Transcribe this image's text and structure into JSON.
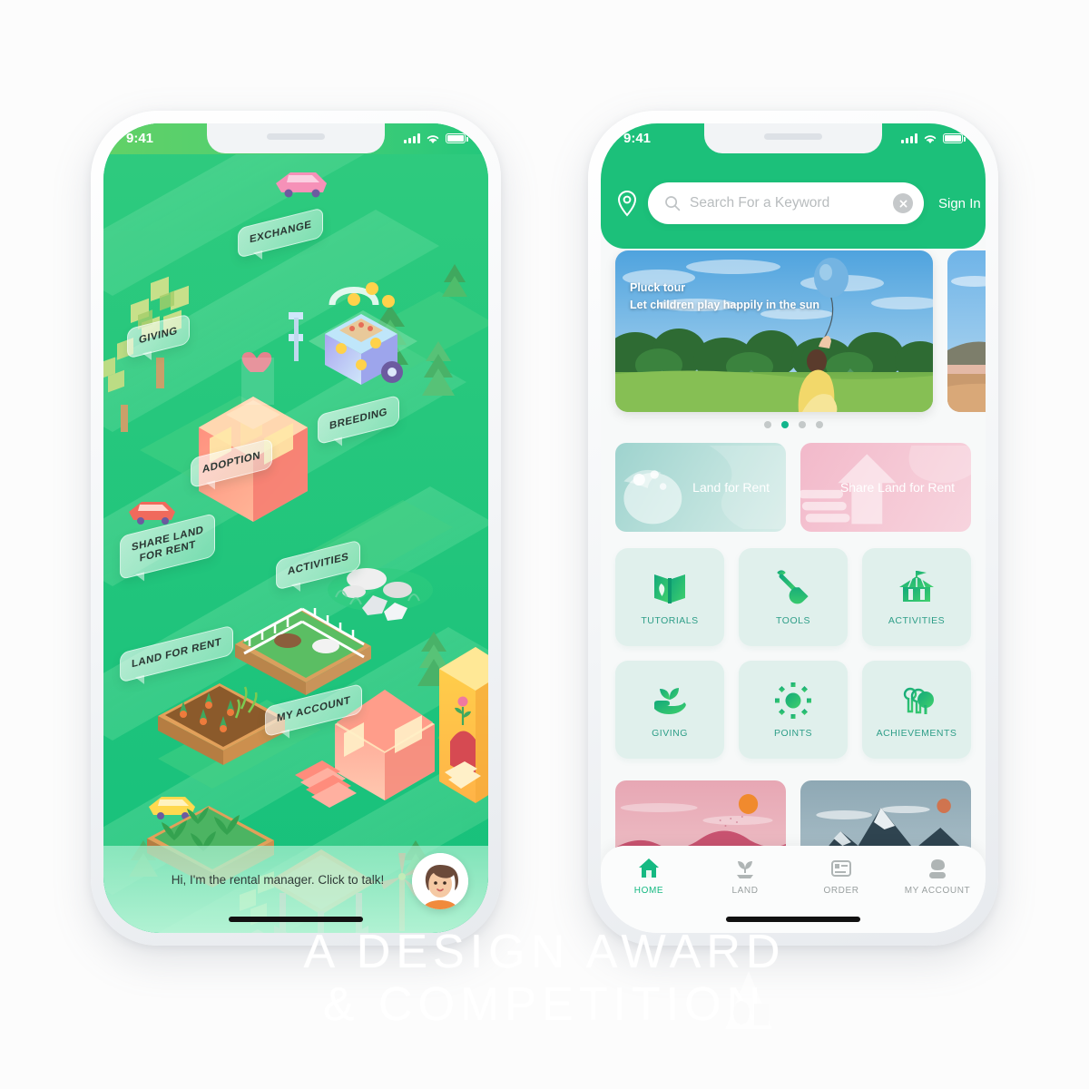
{
  "theme": {
    "brand_green": "#1CC07A",
    "status_green_left": "#4FCF72",
    "tile_bg": "#E0F0EC",
    "tile_label": "#2E9E88",
    "promo_blue": "#9ED3CE",
    "promo_pink": "#F2B9CA",
    "dot_active": "#12B58C"
  },
  "watermark": {
    "line1": "A DESIGN AWARD",
    "line2": "& COMPETITION"
  },
  "left_phone": {
    "status": {
      "time": "9:41",
      "signal_icon": "signal-bars-icon",
      "wifi_icon": "wifi-icon",
      "battery_icon": "battery-icon"
    },
    "map_labels": [
      {
        "text": "EXCHANGE"
      },
      {
        "text": "GIVING"
      },
      {
        "text": "ADOPTION"
      },
      {
        "text": "BREEDING"
      },
      {
        "text": "SHARE LAND\nFOR RENT"
      },
      {
        "text": "ACTIVITIES"
      },
      {
        "text": "LAND FOR RENT"
      },
      {
        "text": "MY ACCOUNT"
      }
    ],
    "chat": {
      "message": "Hi, I'm the rental manager. Click to talk!",
      "avatar_icon": "manager-avatar-icon"
    }
  },
  "right_phone": {
    "status": {
      "time": "9:41",
      "signal_icon": "signal-bars-icon",
      "wifi_icon": "wifi-icon",
      "battery_icon": "battery-icon"
    },
    "header": {
      "location_icon": "location-pin-icon",
      "search_placeholder": "Search For a Keyword",
      "search_value": "",
      "search_icon": "search-icon",
      "clear_icon": "clear-circle-icon",
      "sign_in_label": "Sign In"
    },
    "banner": {
      "title": "Pluck tour",
      "subtitle": "Let children play happily in the sun",
      "dots_total": 4,
      "dots_active_index": 1
    },
    "promos": [
      {
        "label": "Land for Rent",
        "color": "#9ED3CE",
        "icon": "seed-splash-icon"
      },
      {
        "label": "Share Land\nfor Rent",
        "color": "#F2B9CA",
        "icon": "share-arrow-icon"
      }
    ],
    "grid": [
      {
        "label": "TUTORIALS",
        "icon": "book-leaf-icon"
      },
      {
        "label": "TOOLS",
        "icon": "shovel-icon"
      },
      {
        "label": "ACTIVITIES",
        "icon": "tent-icon"
      },
      {
        "label": "GIVING",
        "icon": "hand-plant-icon"
      },
      {
        "label": "POINTS",
        "icon": "sun-icon"
      },
      {
        "label": "ACHIEVEMENTS",
        "icon": "trees-icon"
      }
    ],
    "photos": [
      {
        "name": "pink-dunes-sunset-photo"
      },
      {
        "name": "gray-mountain-photo"
      }
    ],
    "tabs": [
      {
        "label": "HOME",
        "icon": "home-icon",
        "active": true
      },
      {
        "label": "LAND",
        "icon": "sprout-icon",
        "active": false
      },
      {
        "label": "ORDER",
        "icon": "document-icon",
        "active": false
      },
      {
        "label": "MY ACCOUNT",
        "icon": "person-icon",
        "active": false
      }
    ]
  }
}
